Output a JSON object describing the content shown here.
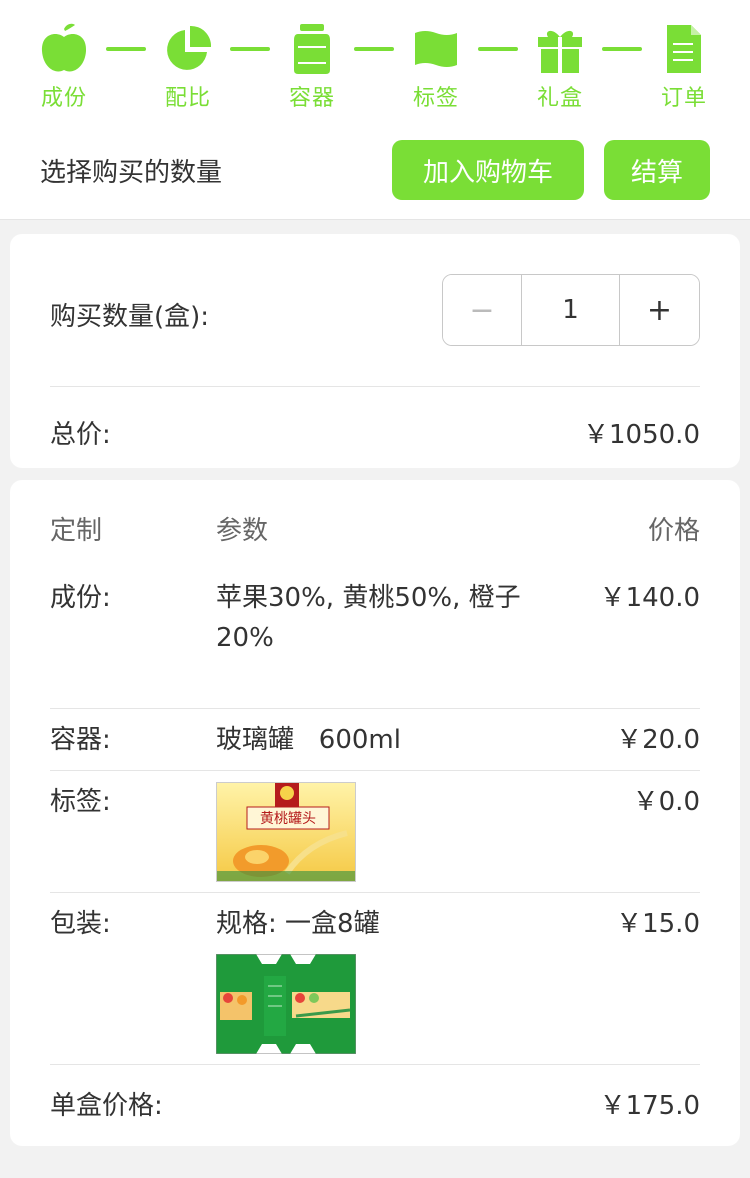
{
  "steps": [
    {
      "label": "成份",
      "icon": "apple-icon"
    },
    {
      "label": "配比",
      "icon": "pie-chart-icon"
    },
    {
      "label": "容器",
      "icon": "jar-icon"
    },
    {
      "label": "标签",
      "icon": "flag-icon"
    },
    {
      "label": "礼盒",
      "icon": "gift-icon"
    },
    {
      "label": "订单",
      "icon": "document-icon"
    }
  ],
  "accent_color": "#7ade36",
  "header": {
    "hint": "选择购买的数量",
    "add_to_cart": "加入购物车",
    "checkout": "结算"
  },
  "quantity": {
    "label": "购买数量(盒):",
    "minus": "−",
    "value": "1",
    "plus": "+"
  },
  "total": {
    "label": "总价:",
    "value": "￥1050.0"
  },
  "table": {
    "headers": {
      "custom": "定制",
      "params": "参数",
      "price": "价格"
    },
    "rows": {
      "ingredients": {
        "label": "成份:",
        "param": "苹果30%, 黄桃50%, 橙子20%",
        "price": "￥140.0"
      },
      "container": {
        "label": "容器:",
        "param": "玻璃罐   600ml",
        "price": "￥20.0"
      },
      "tag": {
        "label": "标签:",
        "price": "￥0.0"
      },
      "packaging": {
        "label": "包装:",
        "param": "规格: 一盒8罐",
        "price": "￥15.0"
      }
    },
    "unit_price": {
      "label": "单盒价格:",
      "value": "￥175.0"
    }
  },
  "label_image_text": "黄桃罐头"
}
